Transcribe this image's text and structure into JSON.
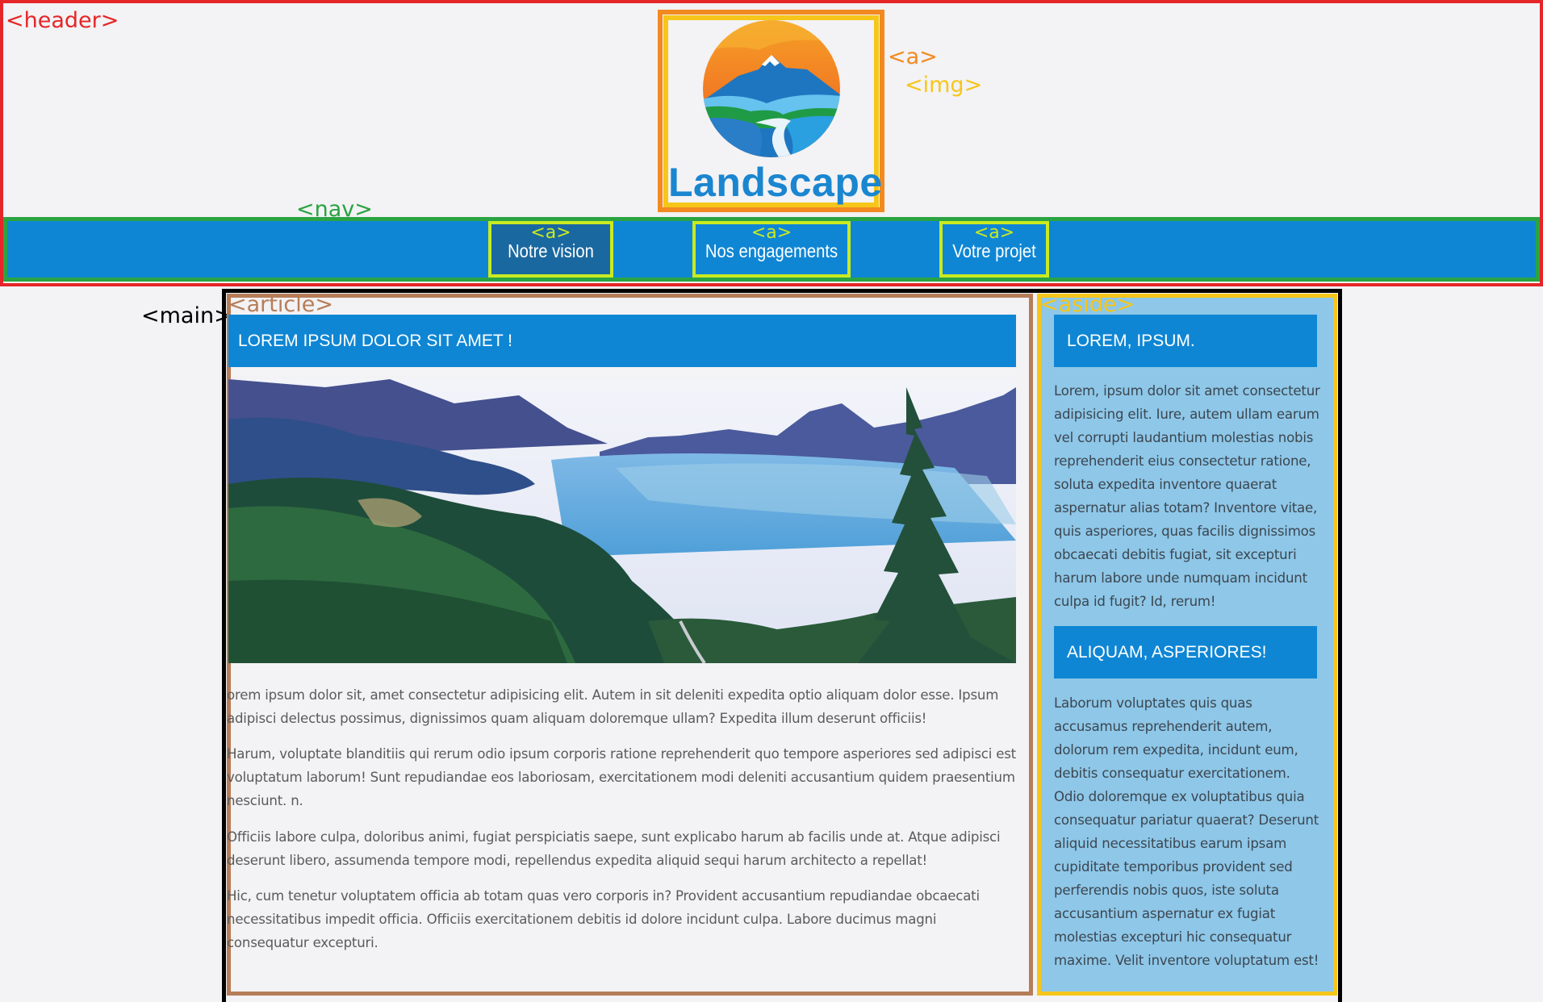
{
  "labels": {
    "header": "<header>",
    "a": "<a>",
    "img": "<img>",
    "nav": "<nav>",
    "main": "<main>",
    "article": "<article>",
    "aside": "<aside>"
  },
  "logo": {
    "text": "Landscape"
  },
  "nav": {
    "tag": "<a>",
    "items": [
      {
        "label": "Notre vision",
        "active": true
      },
      {
        "label": "Nos engagements",
        "active": false
      },
      {
        "label": "Votre projet",
        "active": false
      }
    ]
  },
  "article": {
    "title": "LOREM IPSUM DOLOR SIT AMET !",
    "paragraphs": [
      "orem ipsum dolor sit, amet consectetur adipisicing elit. Autem in sit deleniti expedita optio aliquam dolor esse. Ipsum adipisci delectus possimus, dignissimos quam aliquam doloremque ullam? Expedita illum deserunt officiis!",
      "Harum, voluptate blanditiis qui rerum odio ipsum corporis ratione reprehenderit quo tempore asperiores sed adipisci est voluptatum laborum! Sunt repudiandae eos laboriosam, exercitationem modi deleniti accusantium quidem praesentium nesciunt. n.",
      "Officiis labore culpa, doloribus animi, fugiat perspiciatis saepe, sunt explicabo harum ab facilis unde at. Atque adipisci deserunt libero, assumenda tempore modi, repellendus expedita aliquid sequi harum architecto a repellat!",
      "Hic, cum tenetur voluptatem officia ab totam quas vero corporis in? Provident accusantium repudiandae obcaecati necessitatibus impedit officia. Officiis exercitationem debitis id dolore incidunt culpa. Labore ducimus magni consequatur excepturi."
    ]
  },
  "aside": {
    "sections": [
      {
        "title": "LOREM, IPSUM.",
        "text": "Lorem, ipsum dolor sit amet consectetur adipisicing elit. Iure, autem ullam earum vel corrupti laudantium molestias nobis reprehenderit eius consectetur ratione, soluta expedita inventore quaerat aspernatur alias totam? Inventore vitae, quis asperiores, quas facilis dignissimos obcaecati debitis fugiat, sit excepturi harum labore unde numquam incidunt culpa id fugit? Id, rerum!"
      },
      {
        "title": "ALIQUAM, ASPERIORES!",
        "text": "Laborum voluptates quis quas accusamus reprehenderit autem, dolorum rem expedita, incidunt eum, debitis consequatur exercitationem. Odio doloremque ex voluptatibus quia consequatur pariatur quaerat? Deserunt aliquid necessitatibus earum ipsam cupiditate temporibus provident sed perferendis nobis quos, iste soluta accusantium aspernatur ex fugiat molestias excepturi hic consequatur maxime. Velit inventore voluptatum est!"
      }
    ]
  },
  "colors": {
    "header": "#e52528",
    "a": "#f28a21",
    "img": "#f6c61a",
    "nav": "#2aa342",
    "nav_link": "#c9ea21",
    "nav_bg": "#0f86d4",
    "main": "#000000",
    "article": "#b67d59",
    "aside": "#f6c61a",
    "aside_bg": "#8ec7e8"
  }
}
